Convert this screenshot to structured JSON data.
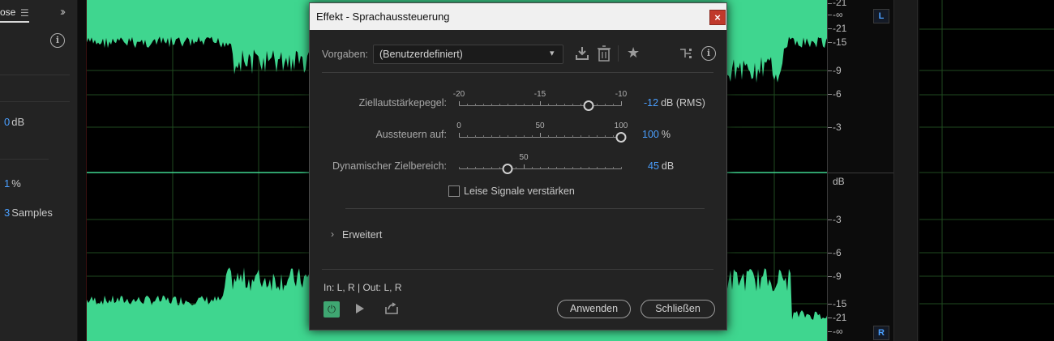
{
  "left_panel": {
    "tab_label": "ose",
    "menu_icon": "hamburger-menu-icon",
    "expand_icon": "double-chevron-right-icon",
    "values": [
      {
        "value": "0",
        "unit": "dB"
      },
      {
        "value": "1",
        "unit": "%"
      },
      {
        "value": "3",
        "unit": "Samples"
      }
    ]
  },
  "ruler": {
    "top_ticks": [
      "-21",
      "-∞",
      "-21",
      "-15",
      "-9",
      "-6",
      "-3"
    ],
    "mid_label": "dB",
    "bottom_ticks": [
      "-3",
      "-6",
      "-9",
      "-15",
      "-21",
      "-∞"
    ],
    "channel_top": "L",
    "channel_bottom": "R"
  },
  "dialog": {
    "title": "Effekt - Sprachaussteuerung",
    "close_label": "×",
    "preset_label": "Vorgaben:",
    "preset_value": "(Benutzerdefiniert)",
    "params": [
      {
        "label": "Ziellautstärkepegel:",
        "scale": [
          "-20",
          "-15",
          "-10"
        ],
        "value": "-12",
        "unit": "dB (RMS)",
        "min": -20,
        "max": -10,
        "current": -12
      },
      {
        "label": "Aussteuern auf:",
        "scale": [
          "0",
          "50",
          "100"
        ],
        "value": "100",
        "unit": "%",
        "min": 0,
        "max": 100,
        "current": 100
      },
      {
        "label": "Dynamischer Zielbereich:",
        "scale": [
          "50"
        ],
        "value": "45",
        "unit": "dB",
        "current": 45
      }
    ],
    "checkbox_label": "Leise Signale verstärken",
    "checkbox_checked": false,
    "advanced_label": "Erweitert",
    "io_label": "In: L, R | Out: L, R",
    "apply_label": "Anwenden",
    "close_button_label": "Schließen"
  },
  "colors": {
    "waveform": "#3fd68f",
    "accent_value": "#4a9fff",
    "close_button": "#c0392b",
    "power_on": "#3fa772"
  }
}
